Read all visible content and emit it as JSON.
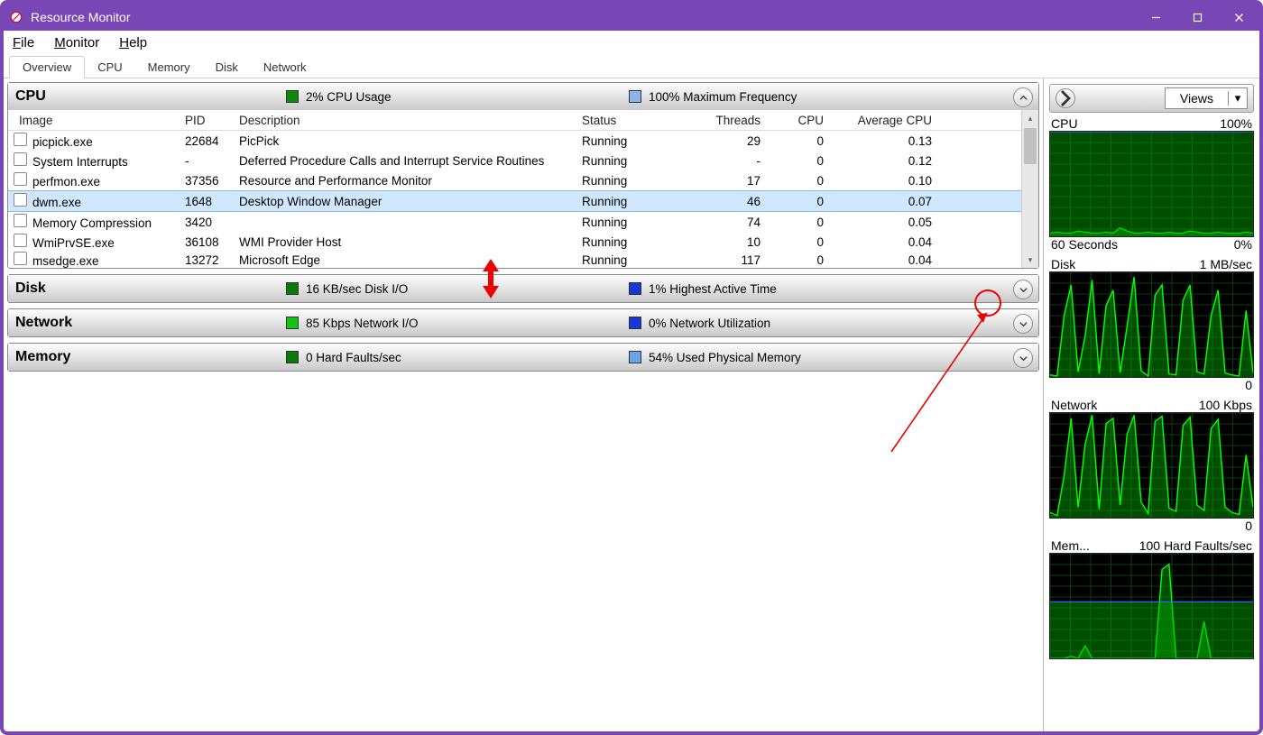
{
  "window": {
    "title": "Resource Monitor"
  },
  "menu": {
    "file": "File",
    "monitor": "Monitor",
    "help": "Help"
  },
  "tabs": {
    "overview": "Overview",
    "cpu": "CPU",
    "memory": "Memory",
    "disk": "Disk",
    "network": "Network"
  },
  "cpu_section": {
    "title": "CPU",
    "stat1": "2% CPU Usage",
    "stat2": "100% Maximum Frequency",
    "columns": {
      "image": "Image",
      "pid": "PID",
      "desc": "Description",
      "status": "Status",
      "threads": "Threads",
      "cpu": "CPU",
      "avgcpu": "Average CPU"
    },
    "rows": [
      {
        "image": "picpick.exe",
        "pid": "22684",
        "desc": "PicPick",
        "status": "Running",
        "threads": "29",
        "cpu": "0",
        "avgcpu": "0.13"
      },
      {
        "image": "System Interrupts",
        "pid": "-",
        "desc": "Deferred Procedure Calls and Interrupt Service Routines",
        "status": "Running",
        "threads": "-",
        "cpu": "0",
        "avgcpu": "0.12"
      },
      {
        "image": "perfmon.exe",
        "pid": "37356",
        "desc": "Resource and Performance Monitor",
        "status": "Running",
        "threads": "17",
        "cpu": "0",
        "avgcpu": "0.10"
      },
      {
        "image": "dwm.exe",
        "pid": "1648",
        "desc": "Desktop Window Manager",
        "status": "Running",
        "threads": "46",
        "cpu": "0",
        "avgcpu": "0.07"
      },
      {
        "image": "Memory Compression",
        "pid": "3420",
        "desc": "",
        "status": "Running",
        "threads": "74",
        "cpu": "0",
        "avgcpu": "0.05"
      },
      {
        "image": "WmiPrvSE.exe",
        "pid": "36108",
        "desc": "WMI Provider Host",
        "status": "Running",
        "threads": "10",
        "cpu": "0",
        "avgcpu": "0.04"
      },
      {
        "image": "msedge.exe",
        "pid": "13272",
        "desc": "Microsoft Edge",
        "status": "Running",
        "threads": "117",
        "cpu": "0",
        "avgcpu": "0.04"
      }
    ],
    "selected_index": 3
  },
  "disk_section": {
    "title": "Disk",
    "stat1": "16 KB/sec Disk I/O",
    "stat2": "1% Highest Active Time"
  },
  "net_section": {
    "title": "Network",
    "stat1": "85 Kbps Network I/O",
    "stat2": "0% Network Utilization"
  },
  "mem_section": {
    "title": "Memory",
    "stat1": "0 Hard Faults/sec",
    "stat2": "54% Used Physical Memory"
  },
  "sidebar": {
    "views_label": "Views",
    "xaxis_label": "60 Seconds",
    "xaxis_zero": "0%",
    "zero": "0",
    "charts": {
      "cpu": {
        "title": "CPU",
        "max": "100%"
      },
      "disk": {
        "title": "Disk",
        "max": "1 MB/sec"
      },
      "net": {
        "title": "Network",
        "max": "100 Kbps"
      },
      "mem": {
        "title": "Mem...",
        "max": "100 Hard Faults/sec"
      }
    }
  },
  "chart_data": [
    {
      "type": "line",
      "title": "CPU",
      "ylim": [
        0,
        100
      ],
      "xwindow_s": 60,
      "series": [
        {
          "name": "cpu%",
          "values": [
            3,
            4,
            3,
            3,
            5,
            4,
            3,
            3,
            4,
            3,
            8,
            5,
            3,
            3,
            4,
            3,
            3,
            4,
            3,
            3,
            5,
            4,
            3,
            3,
            4,
            3,
            3,
            3,
            4,
            3
          ]
        },
        {
          "name": "max_freq%",
          "values": [
            100,
            100,
            100,
            100,
            100,
            100,
            100,
            100,
            100,
            100,
            100,
            100,
            100,
            100,
            100,
            100,
            100,
            100,
            100,
            100,
            100,
            100,
            100,
            100,
            100,
            100,
            100,
            100,
            100,
            100
          ]
        }
      ]
    },
    {
      "type": "area",
      "title": "Disk",
      "ylim_kb_s": [
        0,
        1024
      ],
      "xwindow_s": 60,
      "series": [
        {
          "name": "disk_io_kb_s",
          "values": [
            20,
            10,
            600,
            900,
            50,
            400,
            950,
            30,
            700,
            850,
            40,
            500,
            980,
            60,
            10,
            800,
            900,
            30,
            20,
            750,
            900,
            50,
            30,
            600,
            850,
            40,
            20,
            10,
            650,
            40
          ]
        }
      ]
    },
    {
      "type": "area",
      "title": "Network",
      "ylim_kbps": [
        0,
        100
      ],
      "xwindow_s": 60,
      "series": [
        {
          "name": "net_io_kbps",
          "values": [
            5,
            2,
            40,
            95,
            10,
            70,
            98,
            8,
            90,
            95,
            12,
            80,
            98,
            15,
            4,
            92,
            97,
            9,
            6,
            88,
            96,
            12,
            7,
            85,
            94,
            10,
            5,
            3,
            60,
            10
          ]
        }
      ]
    },
    {
      "type": "line",
      "title": "Memory",
      "ylim_hf_s": [
        0,
        100
      ],
      "xwindow_s": 60,
      "series": [
        {
          "name": "hard_faults_s",
          "values": [
            0,
            0,
            0,
            2,
            0,
            12,
            0,
            0,
            0,
            0,
            0,
            0,
            0,
            0,
            0,
            0,
            85,
            90,
            0,
            0,
            0,
            0,
            35,
            0,
            0,
            0,
            0,
            0,
            0,
            0
          ]
        },
        {
          "name": "used_physical_%",
          "values": [
            54,
            54,
            54,
            54,
            54,
            54,
            54,
            54,
            54,
            54,
            54,
            54,
            54,
            54,
            54,
            54,
            54,
            54,
            54,
            54,
            54,
            54,
            54,
            54,
            54,
            54,
            54,
            54,
            54,
            54
          ]
        }
      ]
    }
  ]
}
